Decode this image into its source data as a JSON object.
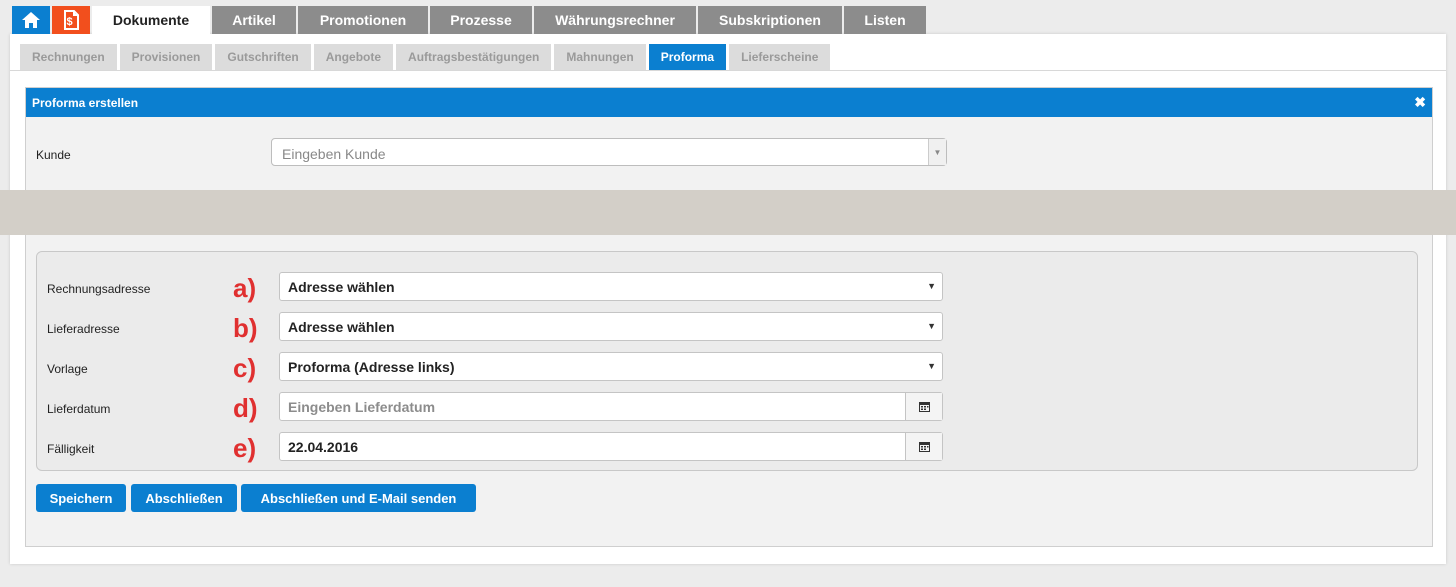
{
  "nav": {
    "main_tabs": [
      {
        "label": "Dokumente",
        "active": true
      },
      {
        "label": "Artikel"
      },
      {
        "label": "Promotionen"
      },
      {
        "label": "Prozesse"
      },
      {
        "label": "Währungsrechner"
      },
      {
        "label": "Subskriptionen"
      },
      {
        "label": "Listen"
      }
    ],
    "sub_tabs": [
      {
        "label": "Rechnungen"
      },
      {
        "label": "Provisionen"
      },
      {
        "label": "Gutschriften"
      },
      {
        "label": "Angebote"
      },
      {
        "label": "Auftragsbestätigungen"
      },
      {
        "label": "Mahnungen"
      },
      {
        "label": "Proforma",
        "active": true
      },
      {
        "label": "Lieferscheine"
      }
    ]
  },
  "panel": {
    "title": "Proforma erstellen",
    "close": "✖"
  },
  "form": {
    "kunde": {
      "label": "Kunde",
      "placeholder": "Eingeben Kunde"
    },
    "rechnungsadresse": {
      "label": "Rechnungsadresse",
      "value": "Adresse wählen",
      "marker": "a)"
    },
    "lieferadresse": {
      "label": "Lieferadresse",
      "value": "Adresse wählen",
      "marker": "b)"
    },
    "vorlage": {
      "label": "Vorlage",
      "value": "Proforma (Adresse links)",
      "marker": "c)"
    },
    "lieferdatum": {
      "label": "Lieferdatum",
      "placeholder": "Eingeben Lieferdatum",
      "marker": "d)"
    },
    "faelligkeit": {
      "label": "Fälligkeit",
      "value": "22.04.2016",
      "marker": "e)"
    }
  },
  "buttons": {
    "save": "Speichern",
    "finish": "Abschließen",
    "finish_email": "Abschließen und E-Mail senden"
  },
  "colors": {
    "accent": "#0b7fd0",
    "doc_icon": "#f24f1d",
    "marker": "#e03030"
  }
}
